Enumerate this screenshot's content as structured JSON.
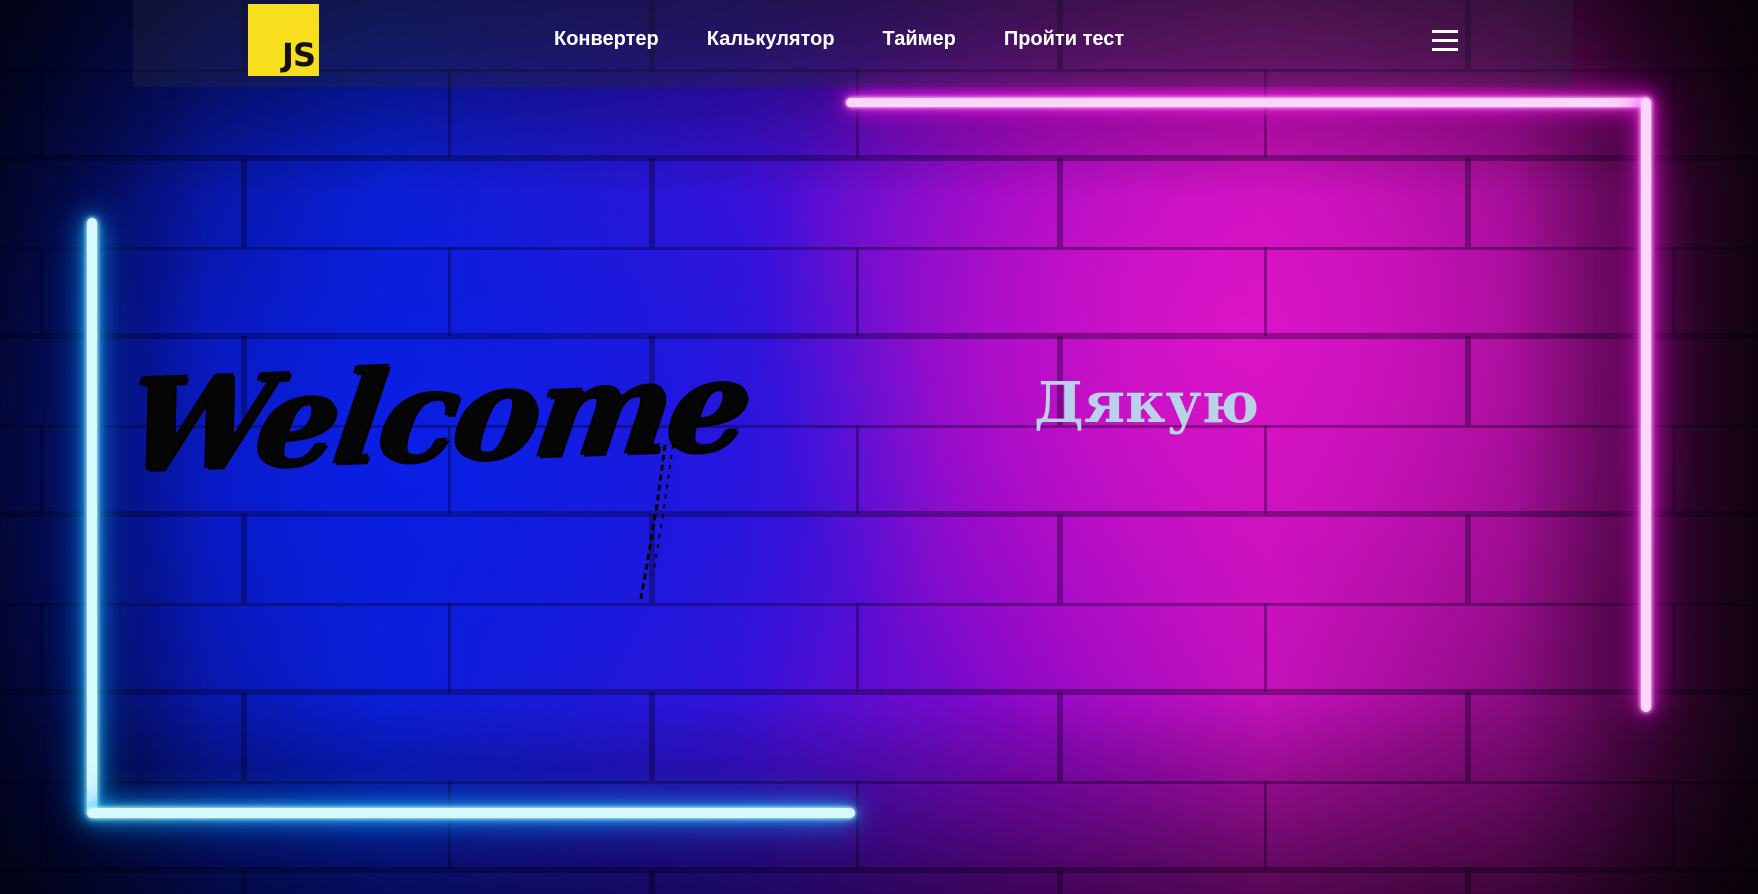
{
  "header": {
    "logo_text": "JS",
    "logo_color": "#f7df1e",
    "nav": [
      {
        "label": "Конвертер"
      },
      {
        "label": "Калькулятор"
      },
      {
        "label": "Таймер"
      },
      {
        "label": "Пройти тест"
      }
    ],
    "menu_icon": "hamburger-menu-icon"
  },
  "hero": {
    "welcome_text": "Welcome",
    "thanks_text": "Дякую",
    "neon_colors": {
      "pink": "#ff1ee8",
      "blue": "#1ab8ff"
    }
  }
}
